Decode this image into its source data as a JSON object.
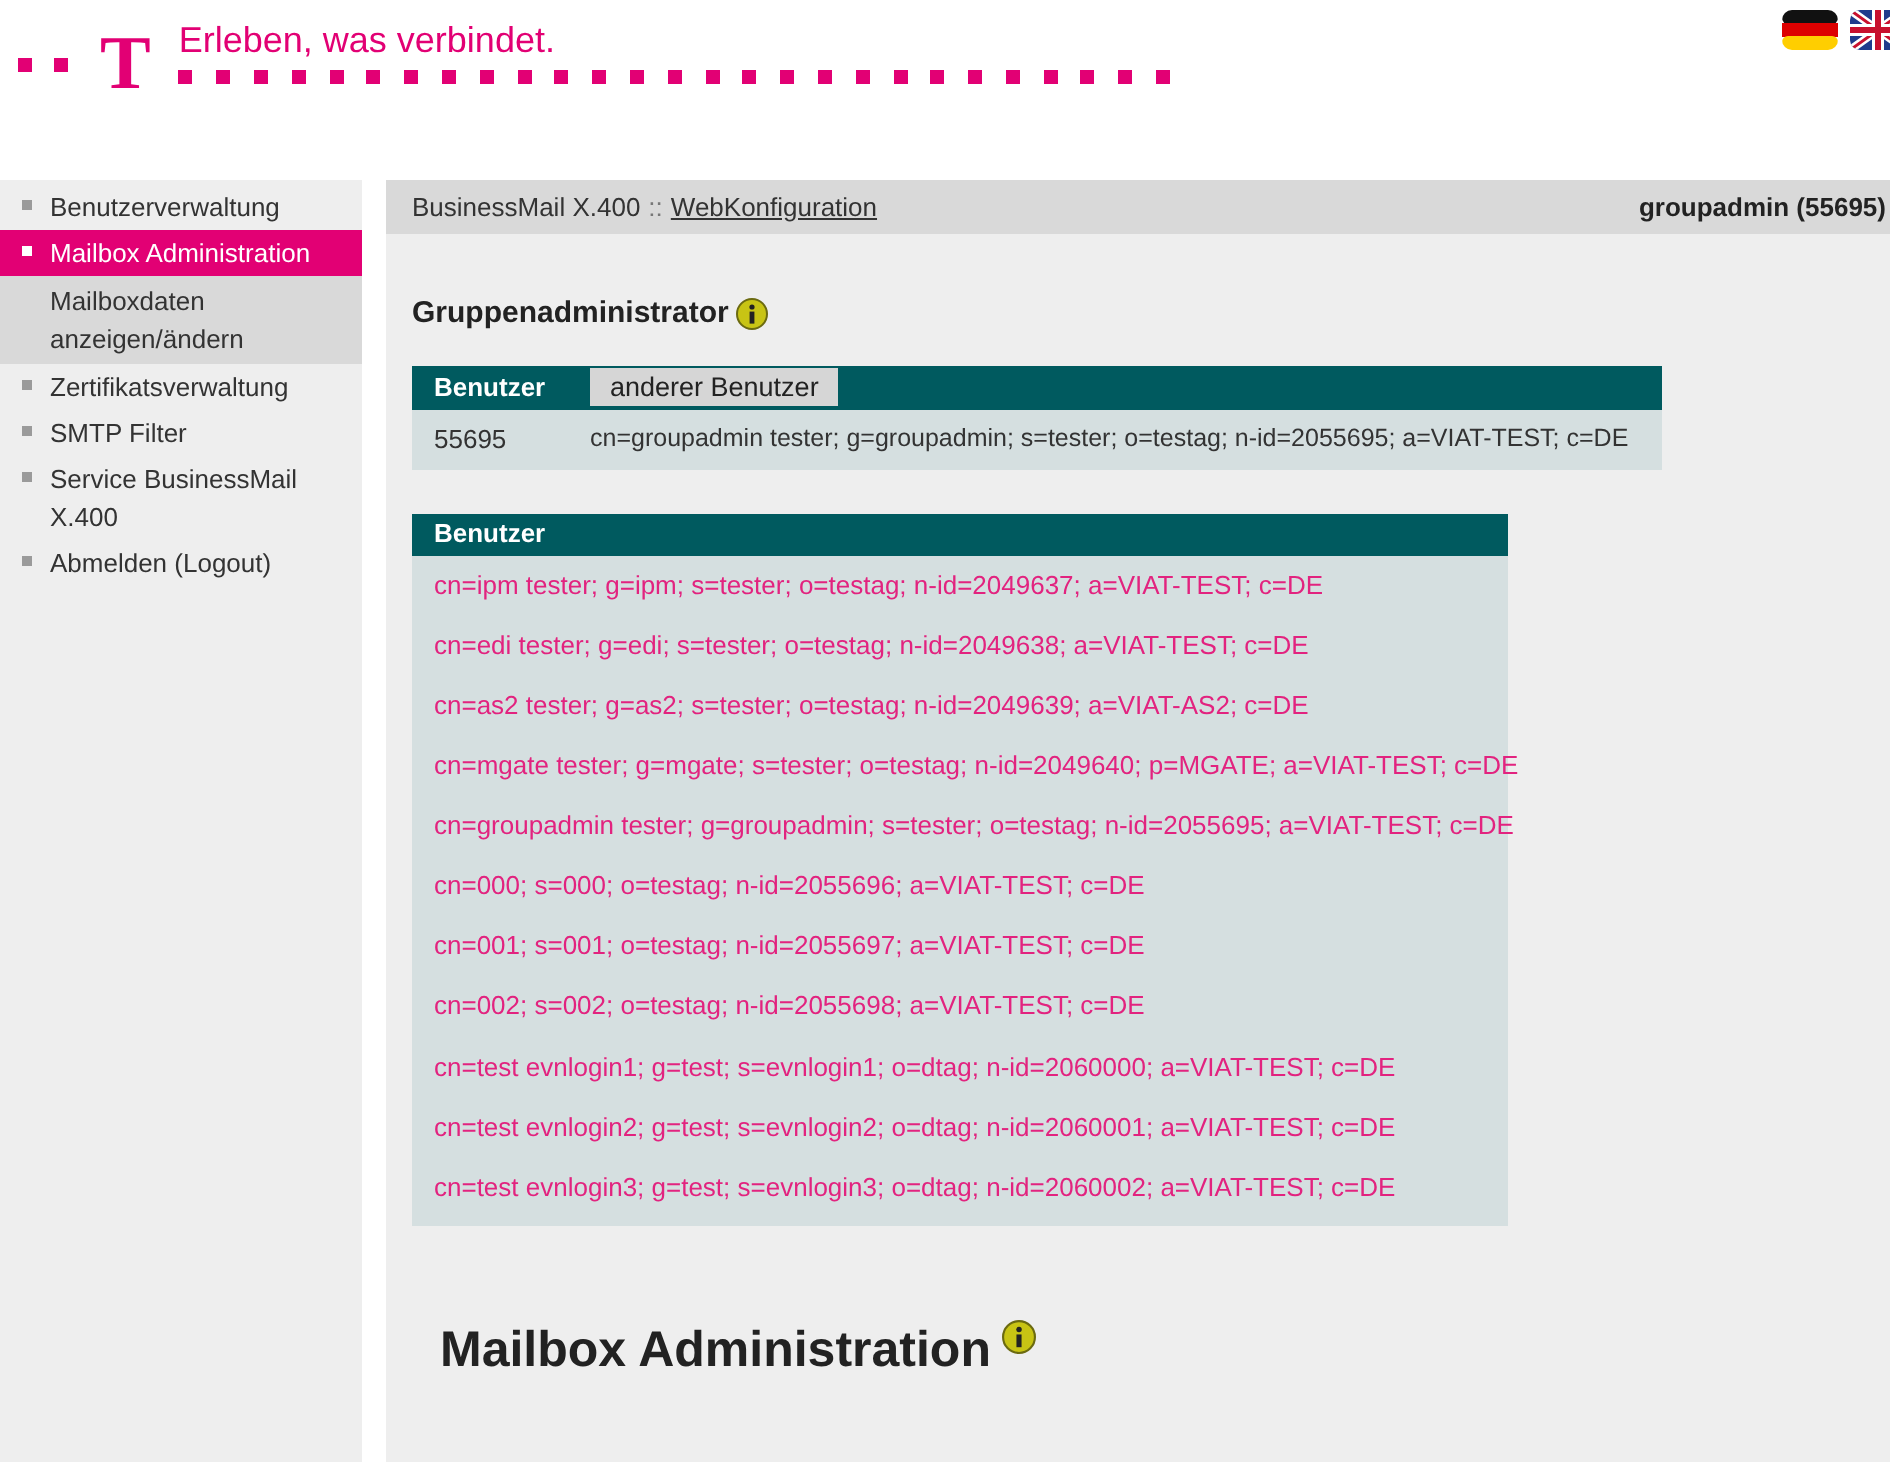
{
  "header": {
    "logo_letter": "T",
    "slogan": "Erleben, was verbindet."
  },
  "languages": [
    {
      "kind": "de",
      "selected": false
    },
    {
      "kind": "en",
      "selected": false
    }
  ],
  "sidebar": {
    "items": [
      {
        "label": "Benutzerverwaltung",
        "selected": false
      },
      {
        "label": "Mailbox Administration",
        "selected": true,
        "children": [
          {
            "label": "Mailboxdaten anzeigen/ändern",
            "selected": true
          }
        ]
      },
      {
        "label": "Zertifikatsverwaltung",
        "selected": false
      },
      {
        "label": "SMTP Filter",
        "selected": false
      },
      {
        "label": "Service BusinessMail X.400",
        "selected": false
      },
      {
        "label": "Abmelden (Logout)",
        "selected": false
      }
    ]
  },
  "breadcrumb": {
    "app": "BusinessMail X.400",
    "separator": "::",
    "link": "WebKonfiguration",
    "user": "groupadmin (55695)"
  },
  "group_admin": {
    "title": "Gruppenadministrator",
    "header": "Benutzer",
    "button": "anderer Benutzer",
    "id": "55695",
    "dn": "cn=groupadmin tester; g=groupadmin; s=tester; o=testag; n-id=2055695; a=VIAT-TEST; c=DE"
  },
  "users": {
    "header": "Benutzer",
    "rows": [
      "cn=ipm tester; g=ipm; s=tester; o=testag; n-id=2049637; a=VIAT-TEST; c=DE",
      "cn=edi tester; g=edi; s=tester; o=testag; n-id=2049638; a=VIAT-TEST; c=DE",
      "cn=as2 tester; g=as2; s=tester; o=testag; n-id=2049639; a=VIAT-AS2; c=DE",
      "cn=mgate tester; g=mgate; s=tester; o=testag; n-id=2049640; p=MGATE; a=VIAT-TEST; c=DE",
      "cn=groupadmin tester; g=groupadmin; s=tester; o=testag; n-id=2055695; a=VIAT-TEST; c=DE",
      "cn=000; s=000; o=testag; n-id=2055696; a=VIAT-TEST; c=DE",
      "cn=001; s=001; o=testag; n-id=2055697; a=VIAT-TEST; c=DE",
      "cn=002; s=002; o=testag; n-id=2055698; a=VIAT-TEST; c=DE",
      "cn=test evnlogin1; g=test; s=evnlogin1; o=dtag; n-id=2060000; a=VIAT-TEST; c=DE",
      "cn=test evnlogin2; g=test; s=evnlogin2; o=dtag; n-id=2060001; a=VIAT-TEST; c=DE",
      "cn=test evnlogin3; g=test; s=evnlogin3; o=dtag; n-id=2060002; a=VIAT-TEST; c=DE"
    ]
  },
  "section_title": "Mailbox Administration"
}
